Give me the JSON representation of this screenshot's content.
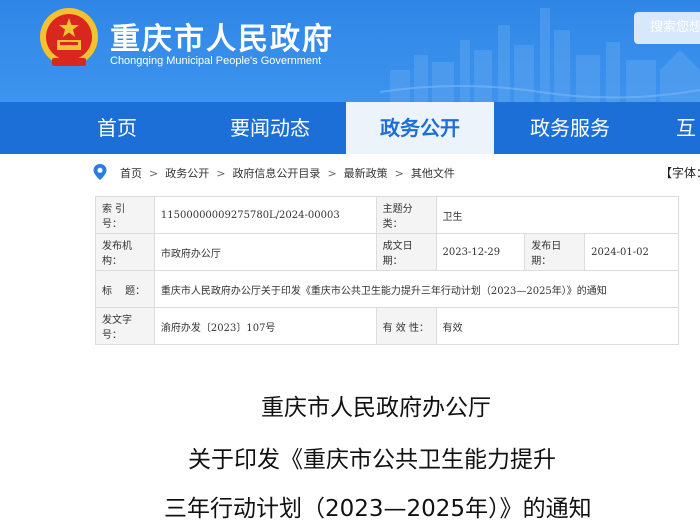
{
  "header": {
    "title": "重庆市人民政府",
    "subtitle": "Chongqing Municipal People's Government",
    "search_label": "搜索您想",
    "emblem_icon": "national-emblem-icon",
    "colors": {
      "header": "#3a8ee8",
      "nav": "#1d6fd8",
      "active_tab": "#edf3fb"
    }
  },
  "nav": {
    "items": [
      {
        "label": "首页"
      },
      {
        "label": "要闻动态"
      },
      {
        "label": "政务公开"
      },
      {
        "label": "政务服务"
      },
      {
        "label": "互"
      }
    ],
    "active": "政务公开"
  },
  "breadcrumb": {
    "items": [
      "首页",
      "政务公开",
      "政府信息公开目录",
      "最新政策",
      "其他文件"
    ],
    "separator": ">",
    "font_size_label": "【字体："
  },
  "meta": {
    "index_label": "索 引 号：",
    "index_value": "11500000009275780L/2024-00003",
    "topic_label": "主题分类：",
    "topic_value": "卫生",
    "issuer_label": "发布机构：",
    "issuer_value": "市政府办公厅",
    "created_label": "成文日期：",
    "created_value": "2023-12-29",
    "published_label": "发布日期：",
    "published_value": "2024-01-02",
    "title_label": "标　 题：",
    "title_value": "重庆市人民政府办公厅关于印发《重庆市公共卫生能力提升三年行动计划（2023—2025年）》的通知",
    "docno_label": "发文字号：",
    "docno_value": "渝府办发〔2023〕107号",
    "validity_label": "有 效 性：",
    "validity_value": "有效"
  },
  "article": {
    "line1": "重庆市人民政府办公厅",
    "line2": "关于印发《重庆市公共卫生能力提升",
    "line3": "三年行动计划（2023—2025年）》的通知"
  }
}
